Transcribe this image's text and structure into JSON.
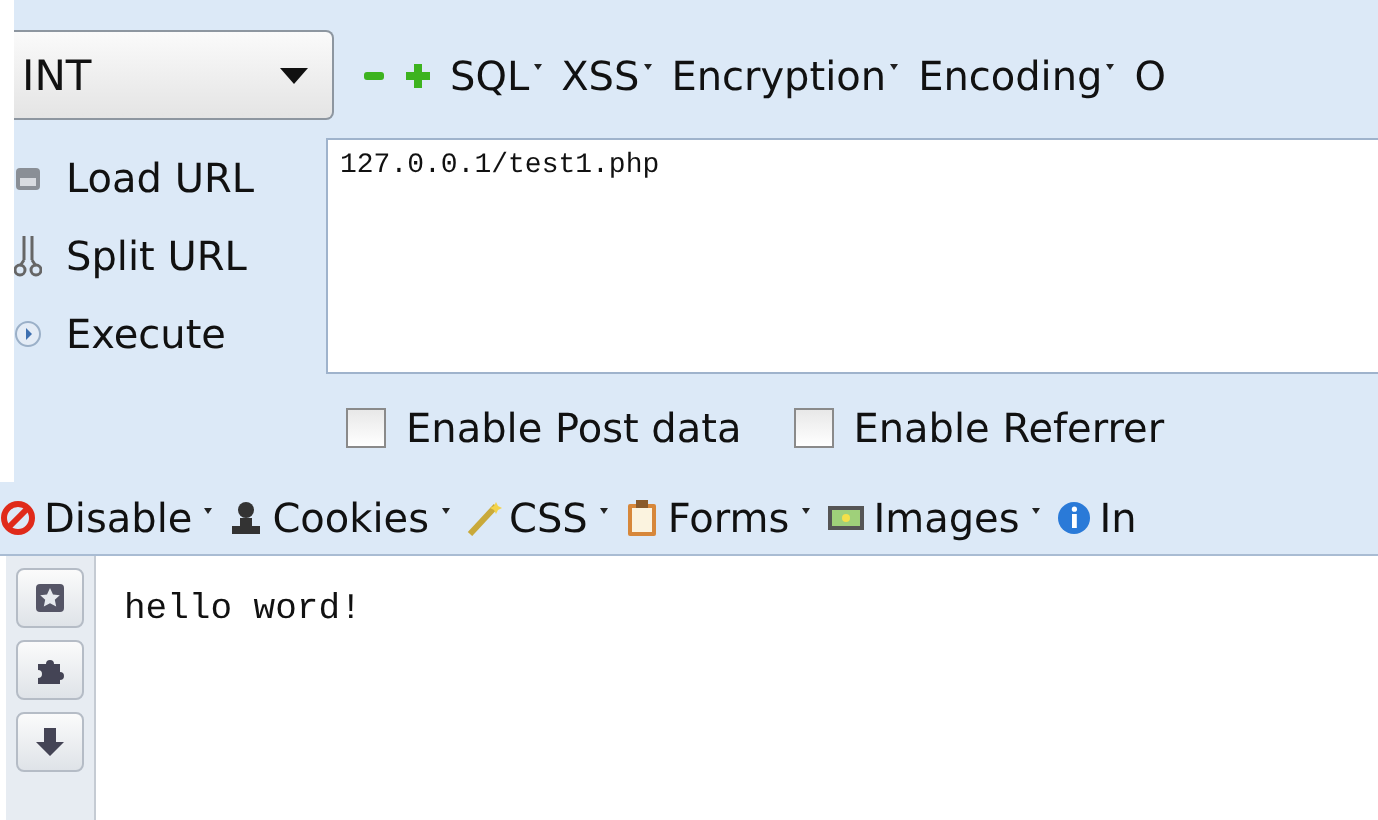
{
  "mode_select": {
    "value": "INT"
  },
  "toolbar": [
    {
      "kind": "minus"
    },
    {
      "kind": "plus"
    },
    {
      "kind": "menu",
      "label": "SQL"
    },
    {
      "kind": "menu",
      "label": "XSS"
    },
    {
      "kind": "menu",
      "label": "Encryption"
    },
    {
      "kind": "menu",
      "label": "Encoding"
    },
    {
      "kind": "text",
      "label": "O"
    }
  ],
  "actions": [
    {
      "kind": "load",
      "label": "Load URL"
    },
    {
      "kind": "split",
      "label": "Split URL"
    },
    {
      "kind": "execute",
      "label": "Execute"
    }
  ],
  "url_field": {
    "value": "127.0.0.1/test1.php"
  },
  "options": [
    {
      "label": "Enable Post data",
      "checked": false
    },
    {
      "label": "Enable Referrer",
      "checked": false
    }
  ],
  "webdev_toolbar": [
    {
      "kind": "disable",
      "label": "Disable",
      "dropdown": true
    },
    {
      "kind": "cookies",
      "label": "Cookies",
      "dropdown": true
    },
    {
      "kind": "css",
      "label": "CSS",
      "dropdown": true
    },
    {
      "kind": "forms",
      "label": "Forms",
      "dropdown": true
    },
    {
      "kind": "images",
      "label": "Images",
      "dropdown": true
    },
    {
      "kind": "info",
      "label": "In",
      "dropdown": false
    }
  ],
  "sidebar_buttons": [
    {
      "kind": "star"
    },
    {
      "kind": "puzzle"
    },
    {
      "kind": "down"
    }
  ],
  "content": {
    "text": "hello word!"
  }
}
